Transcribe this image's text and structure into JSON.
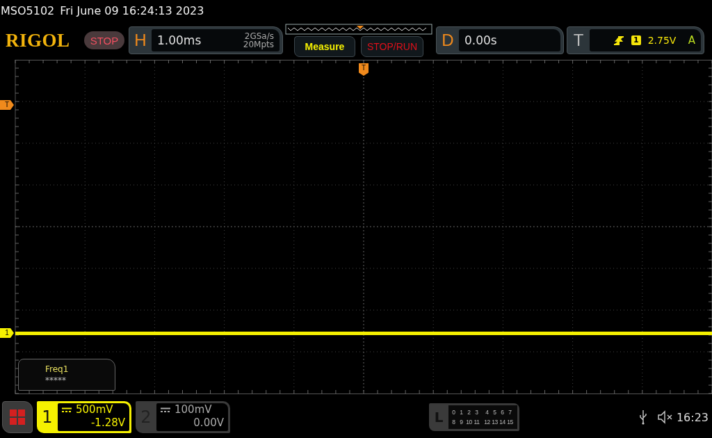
{
  "status_line": {
    "model": "MSO5102",
    "datetime": "Fri June 09 16:24:13 2023"
  },
  "header": {
    "logo": "RIGOL",
    "run_state": "STOP",
    "horizontal": {
      "label": "H",
      "timebase": "1.00ms",
      "sample_rate": "2GSa/s",
      "memory_depth": "20Mpts"
    },
    "buttons": [
      {
        "label": "Measure",
        "kind": "measure"
      },
      {
        "label": "STOP/RUN",
        "kind": "stoprun"
      }
    ],
    "delay": {
      "label": "D",
      "value": "0.00s"
    },
    "trigger": {
      "label": "T",
      "channel": "1",
      "trigger_level": "2.75V",
      "mode": "A"
    }
  },
  "screen": {
    "trigger_marker": "T",
    "level_marker": "T",
    "channel_marker": "1",
    "measurement": {
      "name": "Freq1",
      "value": "*****"
    }
  },
  "channels": [
    {
      "number": "1",
      "scale": "500mV",
      "offset": "-1.28V",
      "selected": true
    },
    {
      "number": "2",
      "scale": "100mV",
      "offset": "0.00V",
      "selected": false
    }
  ],
  "logic": {
    "label": "L",
    "rows": [
      [
        "0",
        "1",
        "2",
        "3",
        "4",
        "5",
        "6",
        "7"
      ],
      [
        "8",
        "9",
        "10",
        "11",
        "12",
        "13",
        "14",
        "15"
      ]
    ]
  },
  "status": {
    "time": "16:23"
  }
}
